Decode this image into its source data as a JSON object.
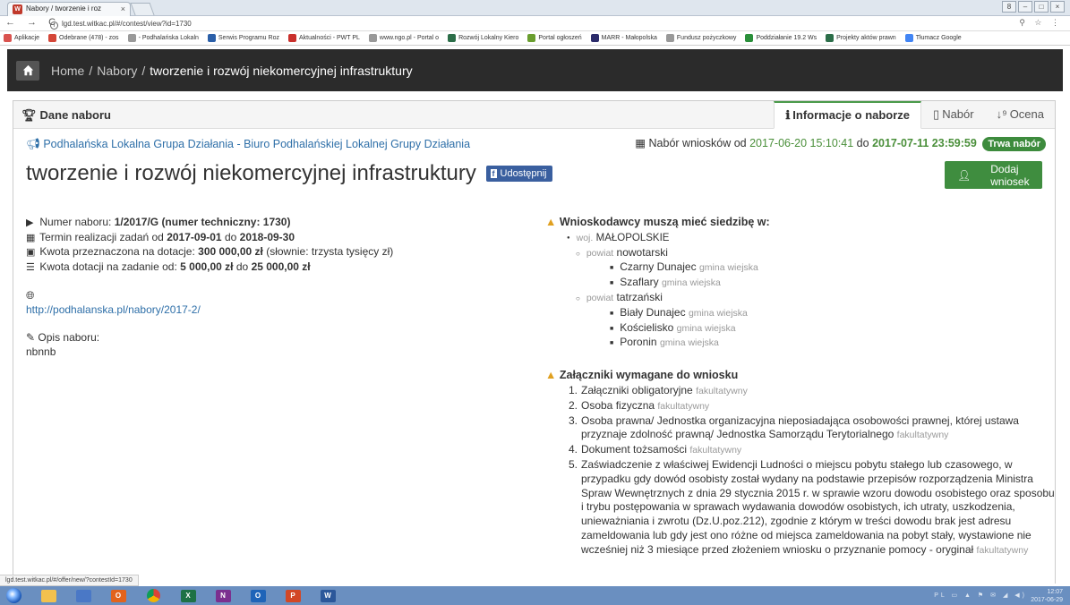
{
  "browser": {
    "tab_title": "Nabory / tworzenie i roz",
    "tab_close": "×",
    "address": "lgd.test.witkac.pl/#/contest/view?id=1730",
    "nav_icons": "← → C",
    "right_icons": "⚲ ☆ ⋮",
    "window_controls": [
      "8",
      "–",
      "□",
      "×"
    ],
    "bookmarks": [
      {
        "label": "Aplikacje",
        "color": "#d9534f"
      },
      {
        "label": "Odebrane (478) - zos",
        "color": "#d44638"
      },
      {
        "label": "- Podhalańska Lokaln",
        "color": "#999999"
      },
      {
        "label": "Serwis Programu Roz",
        "color": "#2b5fa8"
      },
      {
        "label": "Aktualności - PWT PL",
        "color": "#c9302c"
      },
      {
        "label": "www.ngo.pl - Portal o",
        "color": "#999999"
      },
      {
        "label": "Rozwój Lokalny Kiero",
        "color": "#2c6e49"
      },
      {
        "label": "Portal ogłoszeń",
        "color": "#6a9e2f"
      },
      {
        "label": "MARR - Małopolska",
        "color": "#2b2b6a"
      },
      {
        "label": "Fundusz pożyczkowy",
        "color": "#999999"
      },
      {
        "label": "Poddziałanie 19.2 Ws",
        "color": "#2a8f3a"
      },
      {
        "label": "Projekty aktów prawn",
        "color": "#2c6e49"
      },
      {
        "label": "Tłumacz Google",
        "color": "#4285f4"
      }
    ]
  },
  "breadcrumb": {
    "home": "Home",
    "sep": "/",
    "nabory": "Nabory",
    "current": "tworzenie i rozwój niekomercyjnej infrastruktury"
  },
  "panel": {
    "title": "Dane naboru",
    "tabs": {
      "info": "Informacje o naborze",
      "nabor": "Nabór",
      "ocena": "Ocena"
    }
  },
  "org": "Podhalańska Lokalna Grupa Działania - Biuro Podhalańskiej Lokalnej Grupy Działania",
  "dates": {
    "prefix": "Nabór wniosków od",
    "from": "2017-06-20 15:10:41",
    "to_word": "do",
    "to": "2017-07-11 23:59:59",
    "badge": "Trwa nabór"
  },
  "title": "tworzenie i rozwój niekomercyjnej infrastruktury",
  "share_label": "Udostępnij",
  "add_button": "Dodaj wniosek",
  "details": {
    "numer_label": "Numer naboru:",
    "numer_value": "1/2017/G (numer techniczny: 1730)",
    "termin_label": "Termin realizacji zadań od",
    "termin_from": "2017-09-01",
    "termin_do": "do",
    "termin_to": "2018-09-30",
    "kwota_label": "Kwota przeznaczona na dotacje:",
    "kwota_value": "300 000,00 zł",
    "kwota_slownie": "(słownie: trzysta tysięcy zł)",
    "zadanie_label": "Kwota dotacji na zadanie od:",
    "zadanie_from": "5 000,00 zł",
    "zadanie_do": "do",
    "zadanie_to": "25 000,00 zł",
    "link": "http://podhalanska.pl/nabory/2017-2/",
    "opis_label": "Opis naboru:",
    "opis_value": "nbnnb"
  },
  "seat": {
    "heading": "Wnioskodawcy muszą mieć siedzibę w:",
    "woj_prefix": "woj.",
    "woj": "MAŁOPOLSKIE",
    "powiat_prefix": "powiat",
    "powiat1": "nowotarski",
    "p1_gminy": [
      {
        "name": "Czarny Dunajec",
        "type": "gmina wiejska"
      },
      {
        "name": "Szaflary",
        "type": "gmina wiejska"
      }
    ],
    "powiat2": "tatrzański",
    "p2_gminy": [
      {
        "name": "Biały Dunajec",
        "type": "gmina wiejska"
      },
      {
        "name": "Kościelisko",
        "type": "gmina wiejska"
      },
      {
        "name": "Poronin",
        "type": "gmina wiejska"
      }
    ]
  },
  "attachments": {
    "heading": "Załączniki wymagane do wniosku",
    "optional": "fakultatywny",
    "items": [
      "Załączniki obligatoryjne",
      "Osoba fizyczna",
      "Osoba prawna/ Jednostka organizacyjna nieposiadająca osobowości prawnej, której ustawa przyznaje zdolność prawną/ Jednostka Samorządu Terytorialnego",
      "Dokument tożsamości",
      "Zaświadczenie z właściwej Ewidencji Ludności o miejscu pobytu stałego lub czasowego, w przypadku gdy dowód osobisty został wydany na podstawie przepisów rozporządzenia Ministra Spraw Wewnętrznych z dnia 29 stycznia 2015 r. w sprawie wzoru dowodu osobistego oraz sposobu i trybu postępowania w sprawach wydawania dowodów osobistych, ich utraty, uszkodzenia, unieważniania i zwrotu (Dz.U.poz.212), zgodnie z którym w treści dowodu brak jest adresu zameldowania lub gdy jest ono różne od miejsca zameldowania na pobyt stały, wystawione nie wcześniej niż 3 miesiące przed złożeniem wniosku o przyznanie pomocy - oryginał"
    ]
  },
  "status_url": "lgd.test.witkac.pl/#/offer/new/?contestId=1730",
  "taskbar": {
    "apps": [
      "explorer",
      "chrome-window",
      "opera",
      "chrome",
      "excel",
      "onenote",
      "outlook",
      "powerpoint",
      "word"
    ],
    "tray": "PL ▭ ▲ ⚑ ✉ ◢ ◀)",
    "time": "12:07",
    "date": "2017-06-29"
  }
}
